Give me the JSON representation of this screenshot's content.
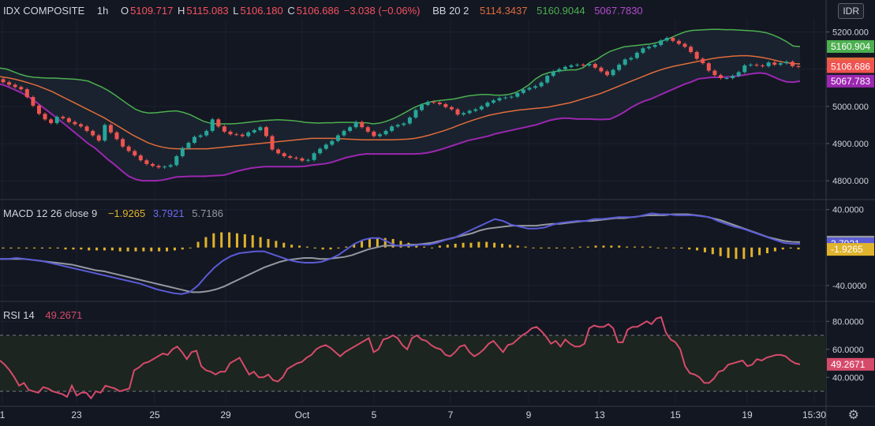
{
  "header": {
    "symbol": "IDX COMPOSITE",
    "interval": "1h",
    "o_label": "O",
    "o_value": "5109.717",
    "h_label": "H",
    "h_value": "5115.083",
    "l_label": "L",
    "l_value": "5106.180",
    "c_label": "C",
    "c_value": "5106.686",
    "change": "−3.038 (−0.06%)",
    "bb_label": "BB 20 2",
    "bb_basis": "5114.3437",
    "bb_upper": "5160.9044",
    "bb_lower": "5067.7830",
    "currency_badge": "IDR"
  },
  "macd_legend": {
    "label": "MACD 12 26 close 9",
    "hist": "−1.9265",
    "macd": "3.7921",
    "signal": "5.7186"
  },
  "rsi_legend": {
    "label": "RSI 14",
    "value": "49.2671"
  },
  "colors": {
    "bg": "#131722",
    "up": "#26a69a",
    "down": "#ef5350",
    "bb_upper": "#4caf50",
    "bb_basis": "#e06c3c",
    "bb_lower": "#9c27b0",
    "macd": "#5b5bd6",
    "signal": "#9598a1",
    "hist": "#e0b32c",
    "rsi": "#d64a6a"
  },
  "chart_data": [
    {
      "type": "candlestick",
      "title": "IDX COMPOSITE",
      "ylim": [
        4760,
        5235
      ],
      "y_ticks": [
        "5200.000",
        "5100.000",
        "5000.000",
        "4900.000",
        "4800.000"
      ],
      "y_tick_values": [
        5200,
        5100,
        5000,
        4900,
        4800
      ],
      "price_labels": [
        {
          "text": "5160.904",
          "value": 5160.904,
          "color": "#4caf50"
        },
        {
          "text": "5114.344",
          "value": 5114.344,
          "color": "#e06c3c"
        },
        {
          "text": "5106.686",
          "value": 5106.686,
          "color": "#ef5350"
        },
        {
          "text": "5067.783",
          "value": 5067.783,
          "color": "#9c27b0"
        }
      ],
      "x_ticks": [
        "1",
        "23",
        "25",
        "29",
        "Oct",
        "5",
        "7",
        "9",
        "13",
        "15",
        "19",
        "15:30"
      ],
      "close": [
        5065,
        5058,
        5052,
        5046,
        5025,
        5002,
        4980,
        4965,
        4955,
        4972,
        4968,
        4958,
        4952,
        4946,
        4934,
        4922,
        4908,
        4950,
        4930,
        4912,
        4892,
        4880,
        4868,
        4855,
        4845,
        4840,
        4836,
        4838,
        4842,
        4866,
        4888,
        4902,
        4918,
        4922,
        4934,
        4965,
        4946,
        4932,
        4925,
        4924,
        4920,
        4930,
        4936,
        4944,
        4920,
        4884,
        4874,
        4866,
        4862,
        4860,
        4854,
        4856,
        4874,
        4886,
        4897,
        4907,
        4922,
        4934,
        4944,
        4958,
        4944,
        4932,
        4920,
        4925,
        4934,
        4946,
        4950,
        4954,
        4970,
        4990,
        5004,
        5012,
        5010,
        5006,
        4998,
        4992,
        4978,
        4982,
        4988,
        4992,
        5000,
        5010,
        5016,
        5022,
        5024,
        5026,
        5036,
        5045,
        5050,
        5054,
        5064,
        5082,
        5094,
        5100,
        5106,
        5110,
        5112,
        5110,
        5114,
        5104,
        5094,
        5084,
        5098,
        5112,
        5126,
        5130,
        5144,
        5156,
        5160,
        5165,
        5177,
        5184,
        5176,
        5168,
        5160,
        5146,
        5128,
        5116,
        5096,
        5084,
        5076,
        5076,
        5082,
        5092,
        5110,
        5112,
        5110,
        5108,
        5118,
        5112,
        5116,
        5120,
        5108,
        5106.686
      ],
      "bb_upper": [
        5103,
        5100,
        5093,
        5086,
        5081,
        5078,
        5077,
        5076,
        5076,
        5075,
        5074,
        5073,
        5071,
        5068,
        5060,
        5052,
        5042,
        5030,
        5017,
        5004,
        4992,
        4985,
        4982,
        4983,
        4985,
        4987,
        4988,
        4984,
        4978,
        4969,
        4960,
        4955,
        4953,
        4953,
        4953,
        4954,
        4956,
        4958,
        4960,
        4962,
        4963,
        4964,
        4963,
        4962,
        4960,
        4957,
        4956,
        4955,
        4956,
        4956,
        4957,
        4957,
        4957,
        4956,
        4956,
        4953,
        4955,
        4960,
        4967,
        4976,
        4986,
        4996,
        5004,
        5010,
        5014,
        5016,
        5018,
        5020,
        5024,
        5028,
        5030,
        5032,
        5032,
        5030,
        5030,
        5032,
        5037,
        5046,
        5058,
        5074,
        5085,
        5091,
        5094,
        5096,
        5098,
        5098,
        5104,
        5118,
        5126,
        5138,
        5148,
        5154,
        5160,
        5162,
        5164,
        5166,
        5168,
        5172,
        5178,
        5185,
        5193,
        5200,
        5204,
        5205,
        5206,
        5207,
        5207,
        5206,
        5206,
        5205,
        5204,
        5203,
        5201,
        5198,
        5192,
        5184,
        5174,
        5162,
        5160.9044
      ],
      "bb_basis": [
        5080,
        5077,
        5073,
        5068,
        5062,
        5056,
        5048,
        5040,
        5030,
        5020,
        5010,
        5000,
        4990,
        4980,
        4970,
        4958,
        4946,
        4934,
        4922,
        4912,
        4902,
        4895,
        4890,
        4887,
        4886,
        4886,
        4886,
        4886,
        4886,
        4888,
        4890,
        4892,
        4894,
        4896,
        4898,
        4900,
        4902,
        4904,
        4906,
        4908,
        4910,
        4912,
        4914,
        4914,
        4914,
        4914,
        4913,
        4912,
        4911,
        4910,
        4910,
        4910,
        4910,
        4910,
        4911,
        4912,
        4914,
        4918,
        4923,
        4929,
        4935,
        4942,
        4950,
        4957,
        4964,
        4970,
        4976,
        4980,
        4984,
        4987,
        4990,
        4992,
        4994,
        4996,
        4998,
        5002,
        5006,
        5010,
        5016,
        5022,
        5028,
        5034,
        5042,
        5050,
        5058,
        5066,
        5074,
        5082,
        5090,
        5097,
        5103,
        5108,
        5112,
        5116,
        5120,
        5124,
        5128,
        5131,
        5133,
        5135,
        5136,
        5136,
        5134,
        5131,
        5127,
        5122,
        5118,
        5115,
        5114.3437
      ],
      "bb_lower": [
        5060,
        5054,
        5046,
        5038,
        5028,
        5016,
        5002,
        4988,
        4974,
        4960,
        4945,
        4930,
        4915,
        4900,
        4888,
        4872,
        4856,
        4842,
        4826,
        4812,
        4804,
        4800,
        4800,
        4800,
        4802,
        4806,
        4810,
        4811,
        4812,
        4812,
        4812,
        4813,
        4814,
        4815,
        4820,
        4826,
        4830,
        4834,
        4836,
        4838,
        4838,
        4838,
        4838,
        4838,
        4838,
        4839,
        4842,
        4844,
        4846,
        4850,
        4856,
        4862,
        4866,
        4870,
        4872,
        4872,
        4872,
        4872,
        4872,
        4872,
        4872,
        4872,
        4873,
        4875,
        4879,
        4884,
        4890,
        4896,
        4902,
        4908,
        4912,
        4916,
        4920,
        4926,
        4930,
        4934,
        4938,
        4942,
        4946,
        4950,
        4956,
        4962,
        4966,
        4968,
        4968,
        4966,
        4966,
        4966,
        4965,
        4965,
        4966,
        4974,
        4984,
        4996,
        5006,
        5014,
        5020,
        5028,
        5036,
        5044,
        5052,
        5060,
        5066,
        5074,
        5076,
        5078,
        5078,
        5079,
        5080,
        5082,
        5085,
        5088,
        5090,
        5088,
        5080,
        5072,
        5066,
        5065,
        5067.783
      ]
    },
    {
      "type": "macd",
      "title": "MACD 12 26 close 9",
      "ylim": [
        -55,
        48
      ],
      "y_ticks": [
        "40.0000",
        "-40.0000"
      ],
      "y_tick_values": [
        40,
        -40
      ],
      "price_labels": [
        {
          "text": "5.7186",
          "value": 5.7186,
          "color": "#9598a1"
        },
        {
          "text": "3.7921",
          "value": 3.7921,
          "color": "#5b5bd6"
        },
        {
          "text": "-1.9265",
          "value": -1.9265,
          "color": "#e0b32c"
        }
      ],
      "macd": [
        -12,
        -12,
        -11,
        -12,
        -13,
        -14,
        -16,
        -18,
        -20,
        -22,
        -24,
        -26,
        -28,
        -30,
        -32,
        -34,
        -36,
        -38,
        -41,
        -44,
        -46,
        -48,
        -49,
        -47,
        -40,
        -30,
        -21,
        -14,
        -9,
        -6,
        -5,
        -4,
        -4,
        -7,
        -10,
        -13,
        -15,
        -16,
        -16,
        -15,
        -12,
        -8,
        -2,
        4,
        8,
        10,
        10,
        6,
        2,
        2,
        2,
        3,
        3,
        5,
        8,
        10,
        14,
        18,
        22,
        26,
        30,
        28,
        24,
        22,
        20,
        20,
        21,
        24,
        26,
        27,
        28,
        28,
        30,
        30,
        31,
        32,
        32,
        32,
        34,
        36,
        35,
        35,
        34,
        34,
        34,
        33,
        32,
        28,
        25,
        22,
        20,
        17,
        14,
        11,
        8,
        5,
        4,
        3.7921
      ],
      "signal": [
        -12,
        -12,
        -12,
        -12,
        -13,
        -14,
        -15,
        -16,
        -17,
        -18,
        -20,
        -22,
        -24,
        -25,
        -27,
        -29,
        -31,
        -33,
        -35,
        -37,
        -39,
        -41,
        -43,
        -45,
        -47,
        -47,
        -46,
        -44,
        -41,
        -37,
        -33,
        -29,
        -25,
        -21,
        -18,
        -15,
        -13,
        -12,
        -11,
        -11,
        -12,
        -12,
        -11,
        -10,
        -8,
        -5,
        -2,
        0,
        2,
        2,
        2,
        3,
        3,
        4,
        5,
        7,
        9,
        11,
        13,
        15,
        18,
        20,
        21,
        22,
        23,
        23,
        23,
        23,
        24,
        25,
        25,
        26,
        27,
        28,
        28,
        29,
        30,
        31,
        31,
        32,
        33,
        34,
        34,
        34,
        35,
        35,
        35,
        34,
        33,
        31,
        29,
        26,
        23,
        20,
        17,
        14,
        11,
        9,
        7,
        6,
        5.7186
      ],
      "hist": [
        -1,
        -1,
        -1,
        -1,
        -1,
        -1,
        -1,
        -1,
        -2,
        -2,
        -2,
        -3,
        -3,
        -3,
        -3,
        -4,
        -4,
        -4,
        -4,
        -4,
        -4,
        -4,
        -3,
        -2,
        0,
        6,
        11,
        15,
        16,
        16,
        15,
        14,
        13,
        11,
        9,
        7,
        5,
        3,
        2,
        1,
        -1,
        -2,
        -2,
        -1,
        1,
        4,
        7,
        9,
        10,
        10,
        9,
        7,
        5,
        3,
        1,
        0,
        2,
        3,
        4,
        5,
        5,
        6,
        6,
        5,
        4,
        3,
        2,
        1,
        0,
        -1,
        -1,
        -1,
        0,
        0,
        1,
        1,
        2,
        2,
        2,
        2,
        1,
        1,
        1,
        1,
        0,
        0,
        0,
        -1,
        -2,
        -3,
        -5,
        -7,
        -9,
        -11,
        -12,
        -12,
        -10,
        -8,
        -6,
        -4,
        -2,
        -1,
        -1.9265
      ]
    },
    {
      "type": "line",
      "title": "RSI 14",
      "ylim": [
        21,
        92
      ],
      "y_ticks": [
        "80.0000",
        "60.0000",
        "40.0000"
      ],
      "y_tick_values": [
        80,
        60,
        40
      ],
      "bands": [
        70,
        30
      ],
      "price_labels": [
        {
          "text": "49.2671",
          "value": 49.2671,
          "color": "#d64a6a"
        }
      ],
      "values": [
        52,
        49,
        45,
        40,
        34,
        36,
        31,
        30,
        29,
        33,
        32,
        30,
        29,
        28,
        26,
        34,
        27,
        29,
        29,
        25,
        30,
        29,
        34,
        33,
        32,
        30,
        31,
        32,
        45,
        47,
        50,
        51,
        53,
        55,
        57,
        56,
        60,
        62,
        58,
        53,
        58,
        59,
        48,
        45,
        44,
        42,
        44,
        44,
        50,
        52,
        54,
        48,
        42,
        44,
        40,
        40,
        42,
        38,
        37,
        40,
        46,
        48,
        50,
        51,
        54,
        56,
        60,
        62,
        63,
        61,
        58,
        55,
        58,
        60,
        62,
        64,
        66,
        68,
        58,
        60,
        67,
        68,
        70,
        68,
        63,
        60,
        68,
        70,
        67,
        66,
        63,
        61,
        60,
        56,
        55,
        58,
        62,
        63,
        58,
        55,
        57,
        60,
        64,
        66,
        62,
        58,
        63,
        64,
        67,
        70,
        72,
        75,
        76,
        73,
        69,
        64,
        66,
        62,
        67,
        64,
        62,
        62,
        64,
        75,
        77,
        76,
        76,
        78,
        75,
        65,
        65,
        74,
        76,
        76,
        78,
        80,
        78,
        82,
        83,
        72,
        67,
        65,
        60,
        48,
        43,
        42,
        40,
        36,
        36,
        39,
        44,
        45,
        49,
        50,
        51,
        52,
        48,
        49,
        53,
        52,
        54,
        55,
        56,
        56,
        55,
        52,
        50,
        49.2671
      ]
    }
  ]
}
